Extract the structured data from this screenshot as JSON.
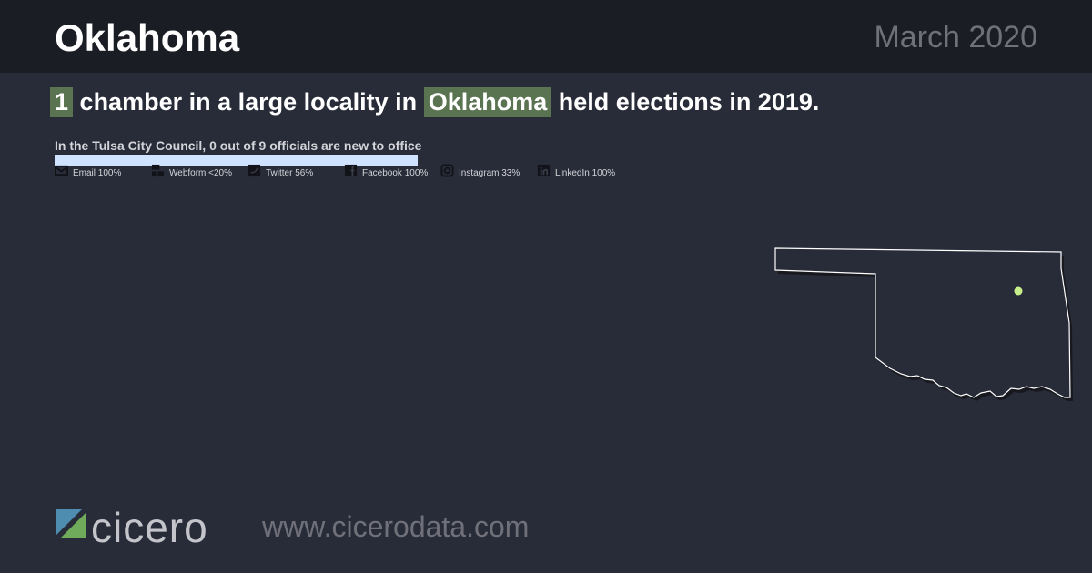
{
  "header": {
    "state": "Oklahoma",
    "date": "March 2020"
  },
  "headline": {
    "count": "1",
    "mid": "chamber in a large locality in",
    "state": "Oklahoma",
    "end": "held elections in 2019."
  },
  "detail": {
    "text": "In the Tulsa City Council, 0 out of 9 officials are new to office",
    "new_fraction": 0
  },
  "contacts": [
    {
      "label": "Email 100%",
      "icon": "email-icon"
    },
    {
      "label": "Webform <20%",
      "icon": "webform-icon"
    },
    {
      "label": "Twitter 56%",
      "icon": "twitter-icon"
    },
    {
      "label": "Facebook 100%",
      "icon": "facebook-icon"
    },
    {
      "label": "Instagram 33%",
      "icon": "instagram-icon"
    },
    {
      "label": "LinkedIn 100%",
      "icon": "linkedin-icon"
    }
  ],
  "map": {
    "region": "Oklahoma",
    "marker": "Tulsa",
    "marker_color": "#c8f08a"
  },
  "footer": {
    "brand": "cicero",
    "url": "www.cicerodata.com"
  },
  "colors": {
    "background": "#282b38",
    "header_bg": "#1b1d24",
    "highlight": "#5a7350",
    "bar": "#cfe2ff",
    "muted_text": "#6f7079"
  }
}
